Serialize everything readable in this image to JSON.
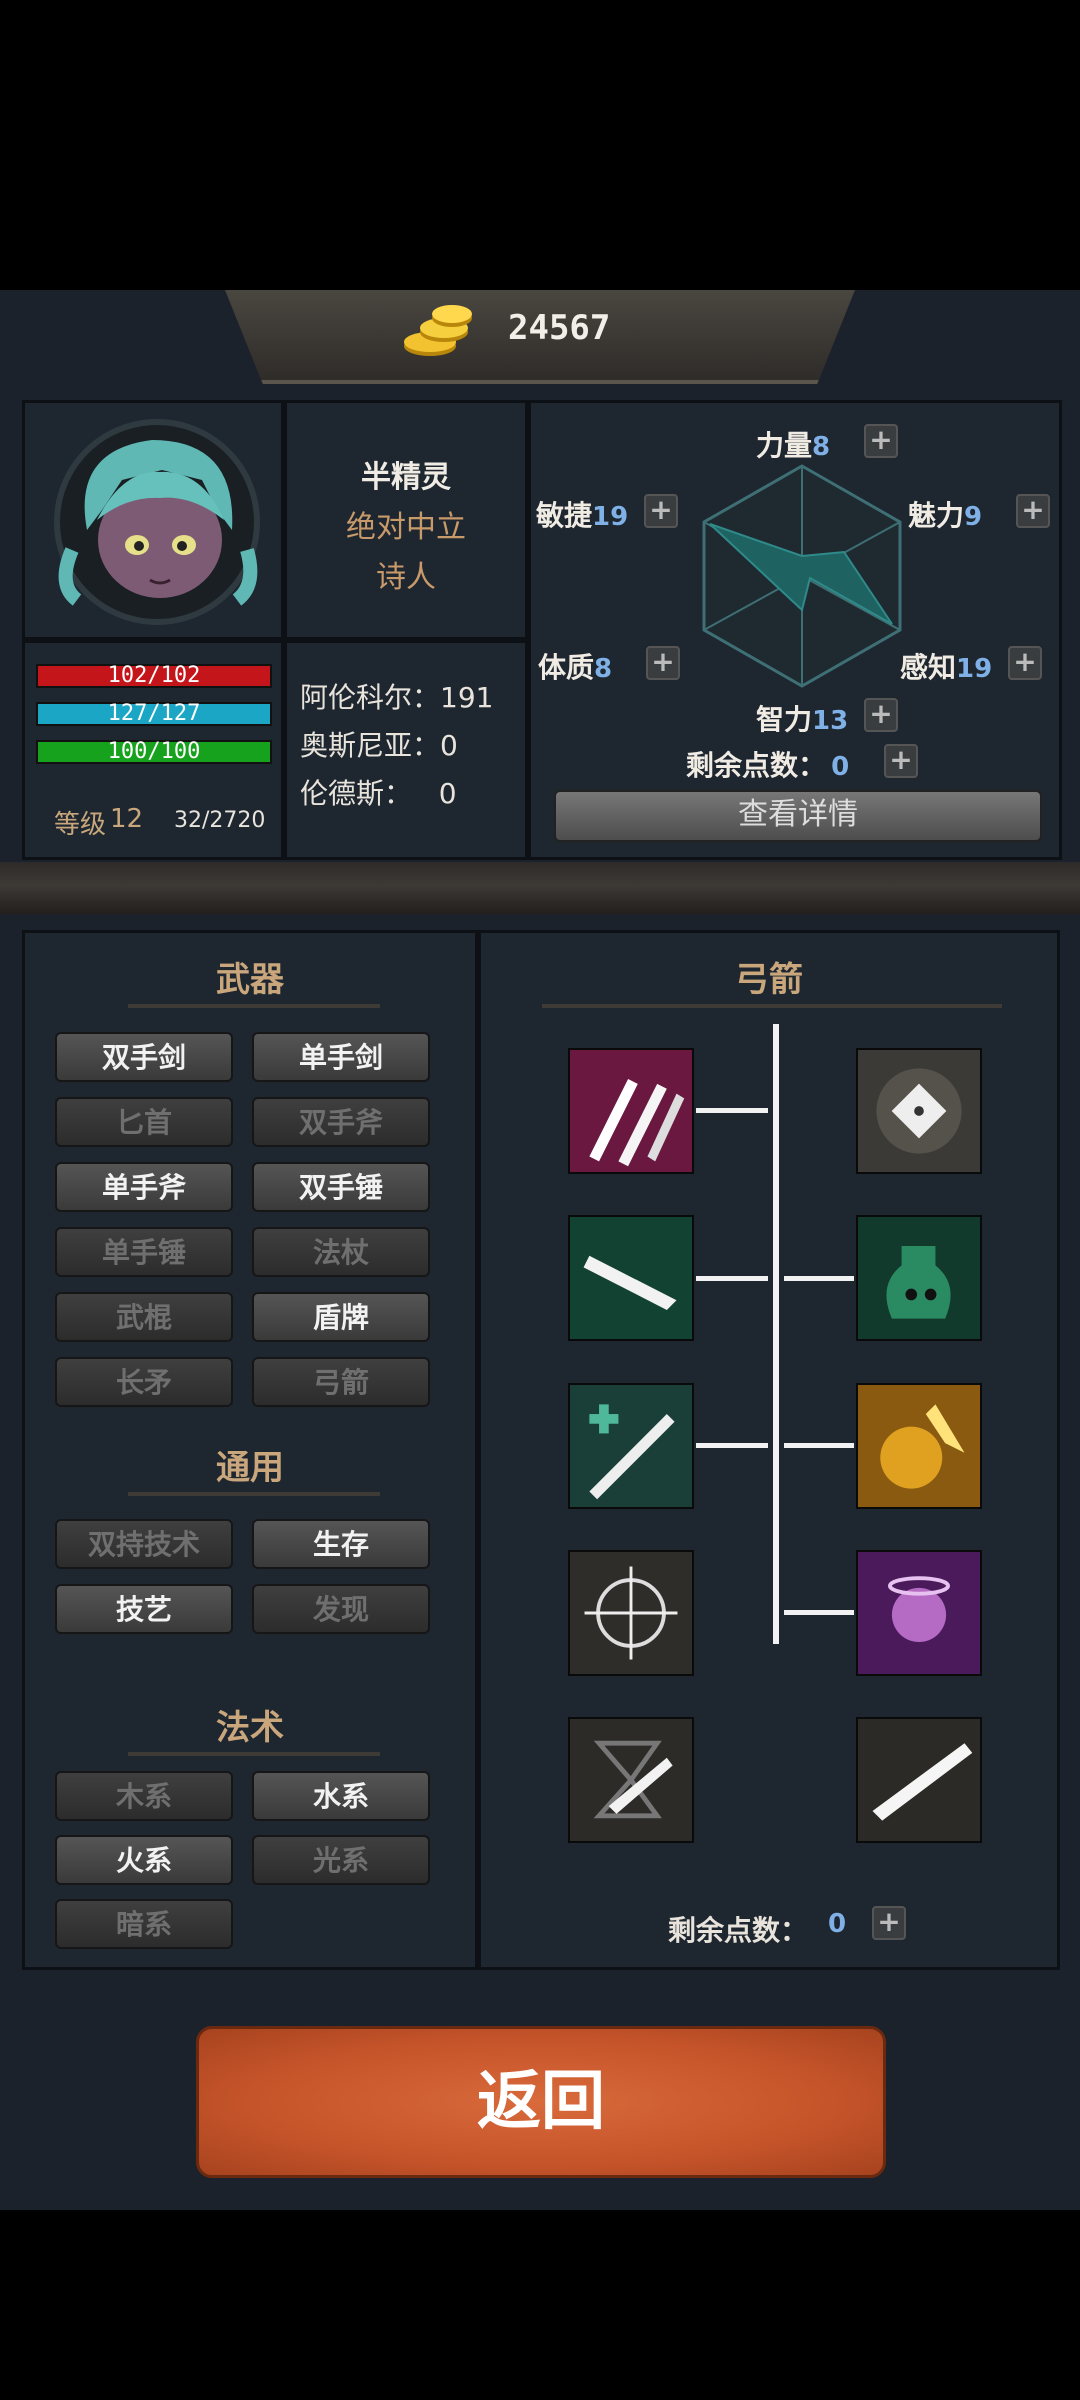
{
  "header": {
    "gold_amount": "24567",
    "coin_icon": "gold-coin-stack"
  },
  "character": {
    "race": "半精灵",
    "alignment": "绝对中立",
    "class": "诗人",
    "hp": "102/102",
    "mp": "127/127",
    "stamina": "100/100",
    "level_label": "等级",
    "level": "12",
    "exp": "32/2720",
    "reputation": [
      {
        "name": "阿伦科尔：",
        "value": "191"
      },
      {
        "name": "奥斯尼亚：",
        "value": "0"
      },
      {
        "name": "伦德斯：",
        "value": "0"
      }
    ]
  },
  "attributes": {
    "strength_label": "力量",
    "strength": "8",
    "agility_label": "敏捷",
    "agility": "19",
    "charm_label": "魅力",
    "charm": "9",
    "constitution_label": "体质",
    "constitution": "8",
    "perception_label": "感知",
    "perception": "19",
    "intelligence_label": "智力",
    "intelligence": "13",
    "remaining_label": "剩余点数：",
    "remaining": "0",
    "details_button": "查看详情",
    "plus": "+"
  },
  "categories": {
    "weapons_title": "武器",
    "weapons": [
      {
        "label": "双手剑",
        "state": "on"
      },
      {
        "label": "单手剑",
        "state": "on"
      },
      {
        "label": "匕首",
        "state": "off"
      },
      {
        "label": "双手斧",
        "state": "off"
      },
      {
        "label": "单手斧",
        "state": "on"
      },
      {
        "label": "双手锤",
        "state": "on"
      },
      {
        "label": "单手锤",
        "state": "off"
      },
      {
        "label": "法杖",
        "state": "off"
      },
      {
        "label": "武棍",
        "state": "off"
      },
      {
        "label": "盾牌",
        "state": "on"
      },
      {
        "label": "长矛",
        "state": "off"
      },
      {
        "label": "弓箭",
        "state": "off"
      }
    ],
    "general_title": "通用",
    "general": [
      {
        "label": "双持技术",
        "state": "off"
      },
      {
        "label": "生存",
        "state": "on"
      },
      {
        "label": "技艺",
        "state": "on"
      },
      {
        "label": "发现",
        "state": "off"
      }
    ],
    "magic_title": "法术",
    "magic": [
      {
        "label": "木系",
        "state": "off"
      },
      {
        "label": "水系",
        "state": "on"
      },
      {
        "label": "火系",
        "state": "on"
      },
      {
        "label": "光系",
        "state": "off"
      },
      {
        "label": "暗系",
        "state": "off"
      }
    ]
  },
  "skill_tree": {
    "title": "弓箭",
    "remaining_label": "剩余点数：",
    "remaining": "0",
    "colors": {
      "magenta": "#7a1a4a",
      "green": "#1f5a46",
      "gold": "#b07a18",
      "purple": "#6a2a7a",
      "grey": "#3a3a36"
    }
  }
}
